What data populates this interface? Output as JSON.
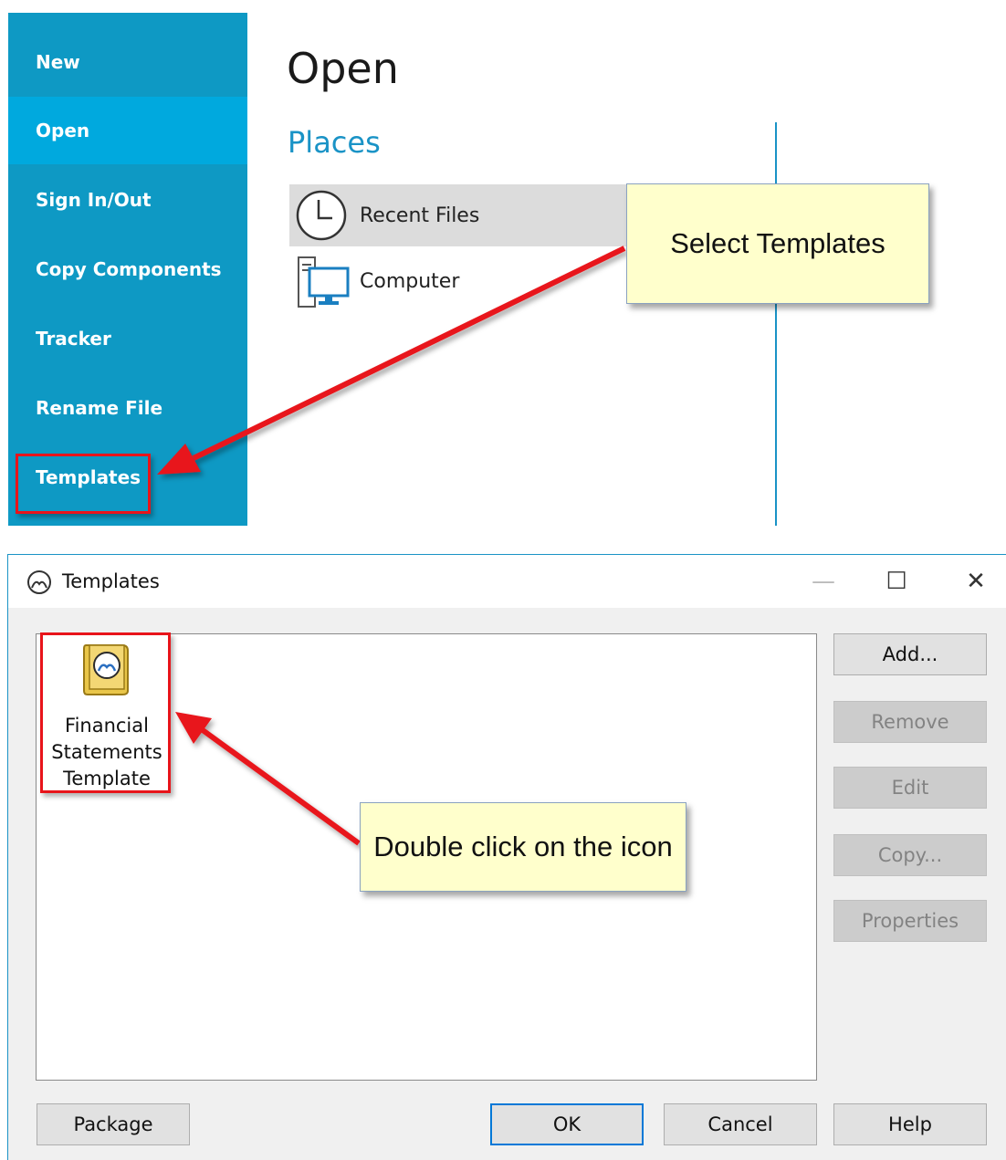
{
  "backstage": {
    "nav": [
      {
        "label": "New"
      },
      {
        "label": "Open"
      },
      {
        "label": "Sign In/Out"
      },
      {
        "label": "Copy Components"
      },
      {
        "label": "Tracker"
      },
      {
        "label": "Rename File"
      },
      {
        "label": "Templates"
      }
    ],
    "selected": "Open",
    "title": "Open",
    "places_title": "Places",
    "places": [
      {
        "label": "Recent Files",
        "icon": "clock-icon"
      },
      {
        "label": "Computer",
        "icon": "computer-icon"
      }
    ]
  },
  "callouts": {
    "top": "Select Templates",
    "bottom": "Double click on the icon"
  },
  "dialog": {
    "title": "Templates",
    "item_label": "Financial Statements Template",
    "side_buttons": [
      {
        "label": "Add...",
        "enabled": true
      },
      {
        "label": "Remove",
        "enabled": false
      },
      {
        "label": "Edit",
        "enabled": false
      },
      {
        "label": "Copy...",
        "enabled": false
      },
      {
        "label": "Properties",
        "enabled": false
      }
    ],
    "package_label": "Package",
    "ok_label": "OK",
    "cancel_label": "Cancel",
    "help_label": "Help",
    "window_controls": {
      "minimize": "—",
      "maximize": "☐",
      "close": "✕"
    }
  },
  "colors": {
    "sidebar": "#0e99c4",
    "sidebar_selected": "#00a9de",
    "accent": "#1a93c6",
    "callout_bg": "#ffffcc",
    "annotation_red": "#e8141a"
  }
}
